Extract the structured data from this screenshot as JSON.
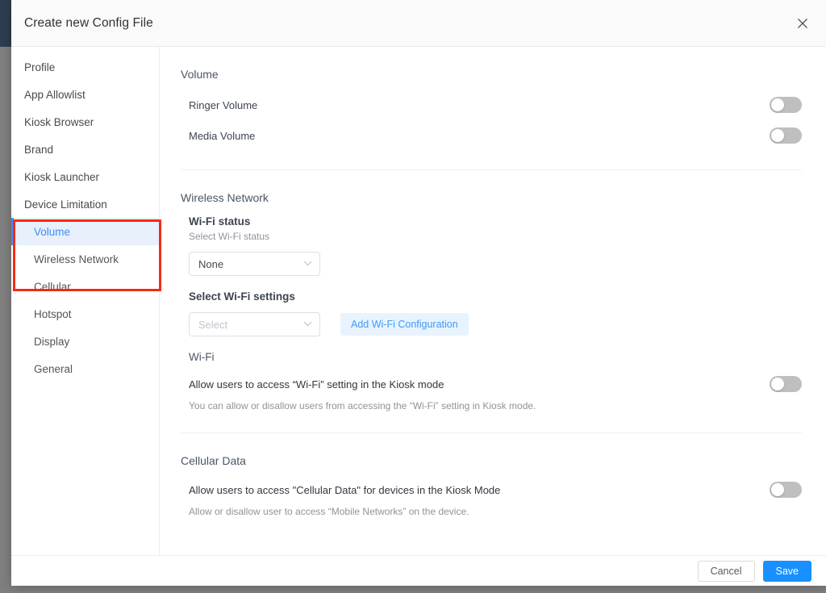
{
  "modal": {
    "title": "Create new Config File",
    "close_icon": "close-icon"
  },
  "sidebar": {
    "items": [
      {
        "label": "Profile",
        "level": "top",
        "active": false
      },
      {
        "label": "App Allowlist",
        "level": "top",
        "active": false
      },
      {
        "label": "Kiosk Browser",
        "level": "top",
        "active": false
      },
      {
        "label": "Brand",
        "level": "top",
        "active": false
      },
      {
        "label": "Kiosk Launcher",
        "level": "top",
        "active": false
      },
      {
        "label": "Device Limitation",
        "level": "top",
        "active": false
      },
      {
        "label": "Volume",
        "level": "sub",
        "active": true
      },
      {
        "label": "Wireless Network",
        "level": "sub",
        "active": false
      },
      {
        "label": "Cellular",
        "level": "sub",
        "active": false
      },
      {
        "label": "Hotspot",
        "level": "sub",
        "active": false
      },
      {
        "label": "Display",
        "level": "sub",
        "active": false
      },
      {
        "label": "General",
        "level": "sub",
        "active": false
      }
    ]
  },
  "annotation": {
    "color": "#f42b13",
    "note": "red highlight around Device Limitation group"
  },
  "content": {
    "volume": {
      "heading": "Volume",
      "ringer_label": "Ringer Volume",
      "ringer_state": "off",
      "media_label": "Media Volume",
      "media_state": "off"
    },
    "wireless": {
      "heading": "Wireless Network",
      "wifi_status_title": "Wi-Fi status",
      "wifi_status_helper": "Select Wi-Fi status",
      "wifi_status_value": "None",
      "wifi_settings_title": "Select Wi-Fi settings",
      "wifi_settings_placeholder": "Select",
      "add_wifi_button": "Add Wi-Fi Configuration",
      "wifi_group_title": "Wi-Fi",
      "wifi_allow_label": "Allow users to access “Wi-Fi” setting in the Kiosk mode",
      "wifi_allow_helper": "You can allow or disallow users from accessing the “Wi-Fi” setting in Kiosk mode.",
      "wifi_allow_state": "off"
    },
    "cellular": {
      "heading": "Cellular Data",
      "allow_label": "Allow users to access \"Cellular Data\" for devices in the Kiosk Mode",
      "allow_helper": "Allow or disallow user to access “Mobile Networks” on the device.",
      "allow_state": "off"
    }
  },
  "footer": {
    "cancel_label": "Cancel",
    "save_label": "Save",
    "save_color": "#1890ff"
  }
}
